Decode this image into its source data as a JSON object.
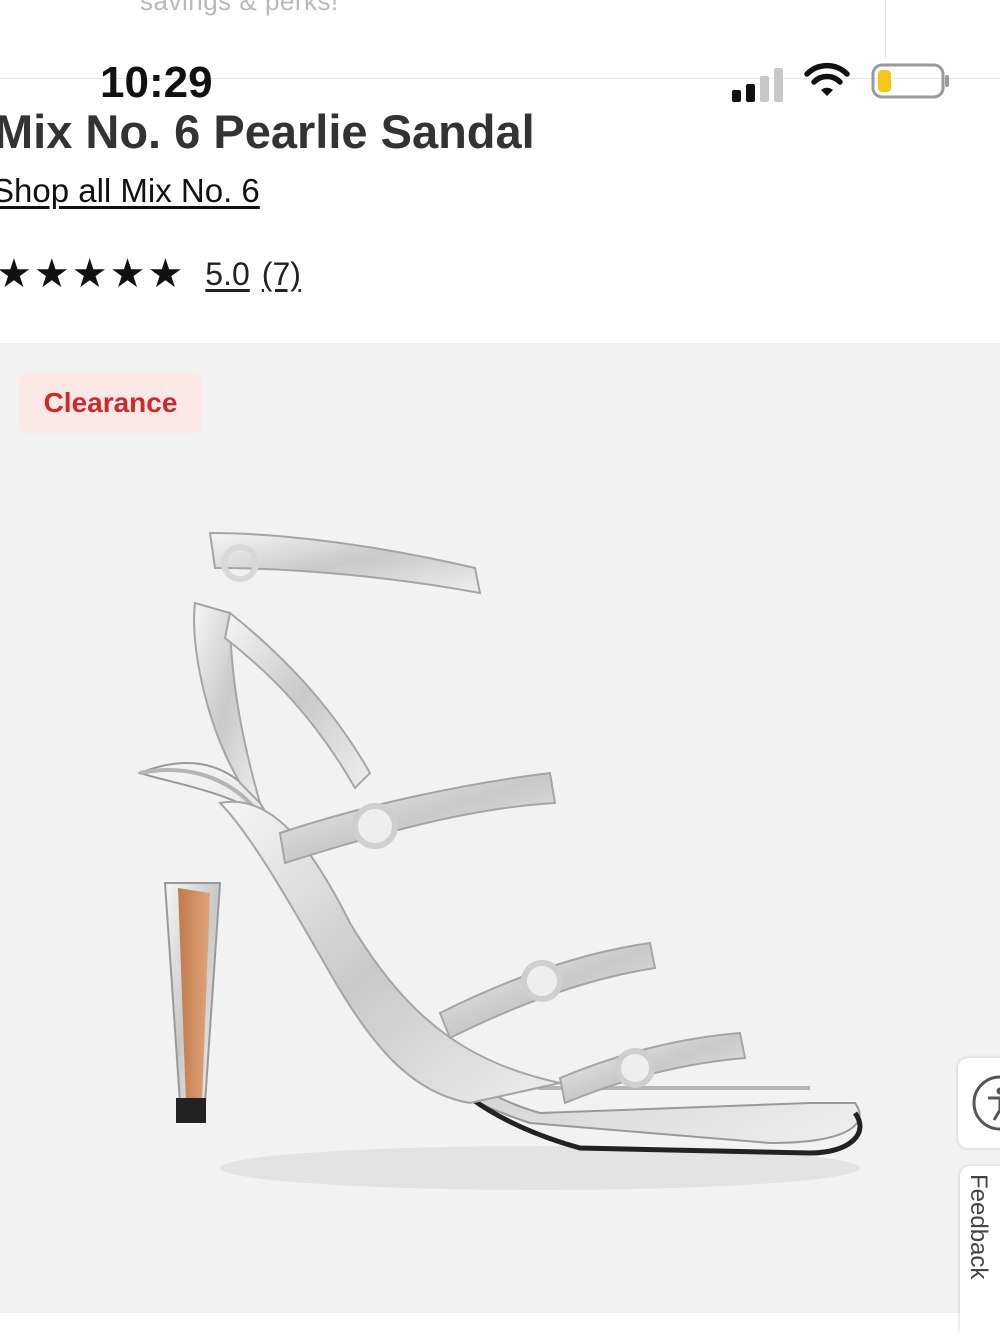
{
  "banner": {
    "promo_text": "savings & perks!"
  },
  "status_bar": {
    "time": "10:29",
    "battery_color": "#f5c518"
  },
  "product": {
    "title": "Mix No. 6 Pearlie Sandal",
    "shop_all_link": "Shop all Mix No. 6",
    "rating_value": "5.0",
    "rating_count": "(7)",
    "stars_filled": 5,
    "badge": "Clearance"
  },
  "side_tabs": {
    "feedback_label": "Feedback"
  },
  "colors": {
    "badge_bg": "#fde8e8",
    "badge_text": "#cc2a2a",
    "media_bg": "#f2f2f2"
  }
}
